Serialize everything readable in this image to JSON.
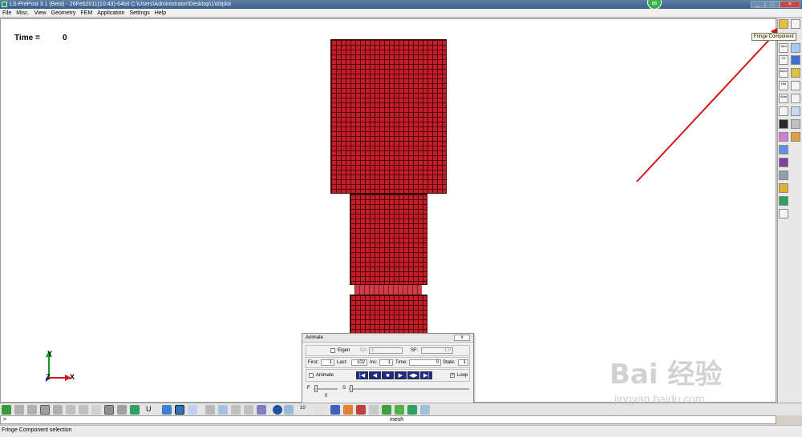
{
  "window": {
    "title": "LS-PrePost 3.1 (Beta) - 26Feb2011(10:43)-64bit C:\\Users\\Administrator\\Desktop\\1\\d3plot",
    "badge": "66"
  },
  "menu": [
    "File",
    "Misc.",
    "View",
    "Geometry",
    "FEM",
    "Application",
    "Settings",
    "Help"
  ],
  "viewport": {
    "time_label": "Time =",
    "time_value": "0",
    "axis": {
      "y": "Y",
      "z": "Z",
      "x": "X"
    }
  },
  "right_toolbar": {
    "tooltip": "Fringe Component",
    "labels": [
      "Stre",
      "XY",
      "Anim",
      "Hst",
      "Ahst"
    ]
  },
  "animate_panel": {
    "title": "Animate",
    "close": "x",
    "eigen_label": "Eigen",
    "dri_label": "Dri",
    "dri_value": "1",
    "sf_label": "SF:",
    "sf_value": "1.0",
    "first_label": "First:",
    "first_value": "1",
    "last_label": "Last:",
    "last_value": "102",
    "inc_label": "Inc:",
    "inc_value": "1",
    "time_label": "Time:",
    "time_value": "0",
    "state_label": "State:",
    "state_value": "1",
    "animate_label": "Animate",
    "loop_label": "Loop",
    "f_label": "F",
    "s_label": "S",
    "f_value": "0"
  },
  "bottom_toolbar": {
    "u_label": "U",
    "num_label": "10"
  },
  "command": {
    "prompt": ">",
    "value": "mesh"
  },
  "status": {
    "text": "Fringe Component selection"
  },
  "watermark": {
    "logo": "Bai 经验",
    "url": "jingyan.baidu.com"
  },
  "colors": {
    "mesh": "#c41e2a",
    "arrow": "#d01818",
    "playback": "#1a2a8a"
  }
}
